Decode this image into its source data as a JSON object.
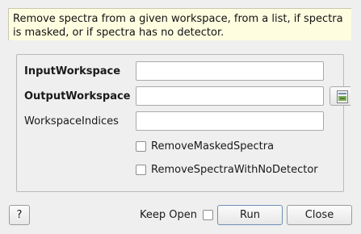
{
  "description": "Remove spectra from a given workspace, from a list, if spectra is masked, or if spectra has no detector.",
  "properties": {
    "input_workspace": {
      "label": "InputWorkspace",
      "value": ""
    },
    "output_workspace": {
      "label": "OutputWorkspace",
      "value": ""
    },
    "workspace_indices": {
      "label": "WorkspaceIndices",
      "value": ""
    },
    "remove_masked_spectra": {
      "label": "RemoveMaskedSpectra",
      "checked": false
    },
    "remove_spectra_with_no_detector": {
      "label": "RemoveSpectraWithNoDetector",
      "checked": false
    }
  },
  "footer": {
    "help_label": "?",
    "keep_open_label": "Keep Open",
    "keep_open_checked": false,
    "run_label": "Run",
    "close_label": "Close"
  },
  "icons": {
    "browse": "workspace-browse-icon"
  }
}
